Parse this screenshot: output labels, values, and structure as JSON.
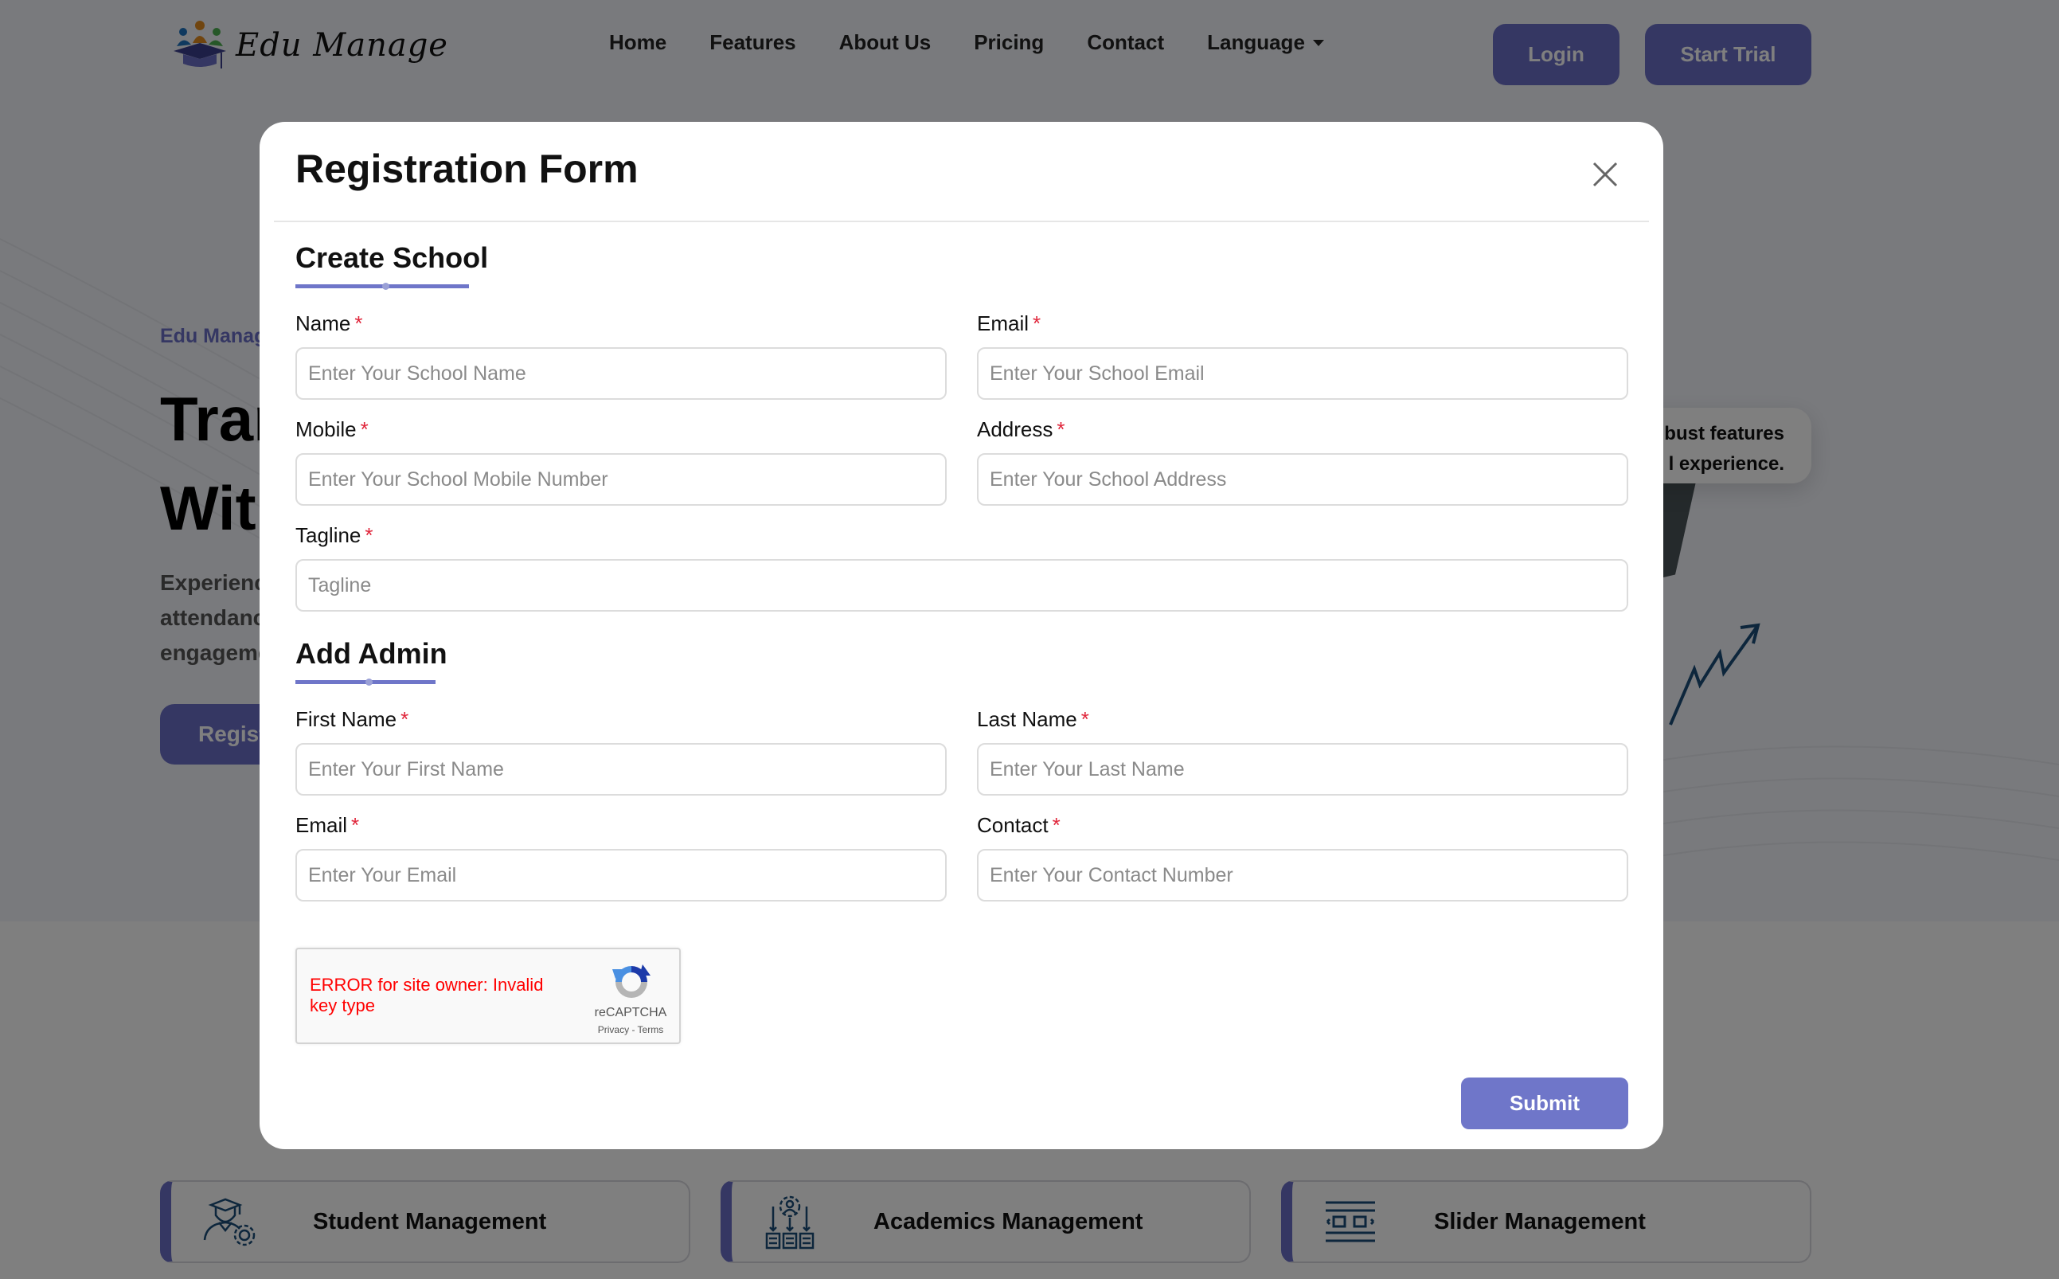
{
  "brand": {
    "name": "Edu Manage"
  },
  "nav": {
    "links": [
      "Home",
      "Features",
      "About Us",
      "Pricing",
      "Contact"
    ],
    "language": "Language",
    "login": "Login",
    "start_trial": "Start Trial"
  },
  "hero": {
    "tag": "Edu Manag",
    "title_line1": "Tran",
    "title_line2": "Wit",
    "desc_line1": "Experienc",
    "desc_line2": "attendanc",
    "desc_line3": "engageme",
    "button": "Regist",
    "bubble_line1": "bust features",
    "bubble_line2": "l experience."
  },
  "features": [
    {
      "label": "Student Management",
      "icon": "student-gear-icon"
    },
    {
      "label": "Academics Management",
      "icon": "academics-icon"
    },
    {
      "label": "Slider Management",
      "icon": "slider-icon"
    }
  ],
  "modal": {
    "title": "Registration Form",
    "school_section": "Create School",
    "admin_section": "Add Admin",
    "required_mark": "*",
    "fields": {
      "school_name": {
        "label": "Name",
        "placeholder": "Enter Your School Name",
        "value": ""
      },
      "school_email": {
        "label": "Email",
        "placeholder": "Enter Your School Email",
        "value": ""
      },
      "school_mobile": {
        "label": "Mobile",
        "placeholder": "Enter Your School Mobile Number",
        "value": ""
      },
      "school_address": {
        "label": "Address",
        "placeholder": "Enter Your School Address",
        "value": ""
      },
      "tagline": {
        "label": "Tagline",
        "placeholder": "Tagline",
        "value": ""
      },
      "first_name": {
        "label": "First Name",
        "placeholder": "Enter Your First Name",
        "value": ""
      },
      "last_name": {
        "label": "Last Name",
        "placeholder": "Enter Your Last Name",
        "value": ""
      },
      "admin_email": {
        "label": "Email",
        "placeholder": "Enter Your Email",
        "value": ""
      },
      "contact": {
        "label": "Contact",
        "placeholder": "Enter Your Contact Number",
        "value": ""
      }
    },
    "recaptcha": {
      "error": "ERROR for site owner: Invalid key type",
      "brand": "reCAPTCHA",
      "links": "Privacy - Terms"
    },
    "submit": "Submit"
  },
  "colors": {
    "accent": "#6f76c9",
    "required": "#e0263b",
    "error": "#ff0000"
  }
}
